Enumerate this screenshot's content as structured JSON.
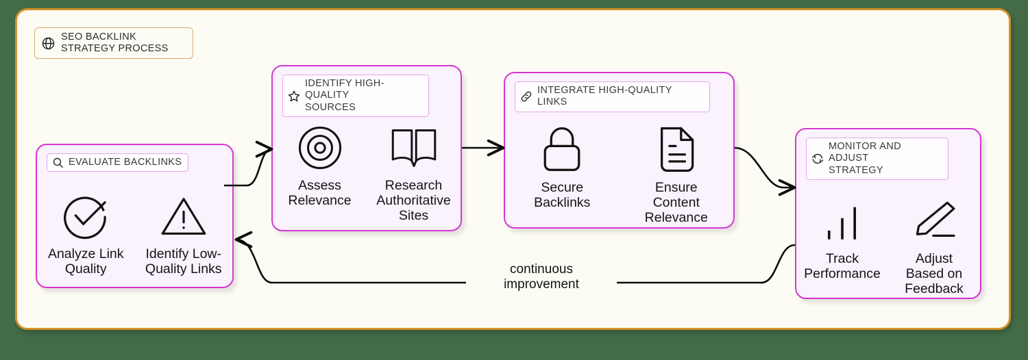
{
  "canvas": {
    "background_color": "#436b46",
    "frame_background": "#fdfcf4",
    "frame_border_color": "#d4922a",
    "box_fill": "#faf2fc",
    "box_border_color": "#d436d6",
    "badge_border_color": "#e4a6ea"
  },
  "title": {
    "icon": "globe-icon",
    "label": "SEO BACKLINK STRATEGY PROCESS"
  },
  "stages": [
    {
      "id": "evaluate-backlinks",
      "icon": "search-icon",
      "label": "EVALUATE BACKLINKS",
      "items": [
        {
          "icon": "check-circle-icon",
          "label": "Analyze Link\nQuality"
        },
        {
          "icon": "warning-triangle-icon",
          "label": "Identify Low-\nQuality Links"
        }
      ]
    },
    {
      "id": "identify-high-quality-sources",
      "icon": "star-icon",
      "label": "IDENTIFY HIGH-QUALITY\nSOURCES",
      "items": [
        {
          "icon": "target-icon",
          "label": "Assess\nRelevance"
        },
        {
          "icon": "open-book-icon",
          "label": "Research\nAuthoritative\nSites"
        }
      ]
    },
    {
      "id": "integrate-high-quality-links",
      "icon": "link-chain-icon",
      "label": "INTEGRATE HIGH-QUALITY LINKS",
      "items": [
        {
          "icon": "lock-icon",
          "label": "Secure\nBacklinks"
        },
        {
          "icon": "document-icon",
          "label": "Ensure\nContent\nRelevance"
        }
      ]
    },
    {
      "id": "monitor-and-adjust-strategy",
      "icon": "refresh-cycle-icon",
      "label": "MONITOR AND ADJUST\nSTRATEGY",
      "items": [
        {
          "icon": "bar-chart-icon",
          "label": "Track\nPerformance"
        },
        {
          "icon": "pencil-icon",
          "label": "Adjust\nBased on\nFeedback"
        }
      ]
    }
  ],
  "feedback_loop": {
    "label": "continuous\nimprovement"
  }
}
